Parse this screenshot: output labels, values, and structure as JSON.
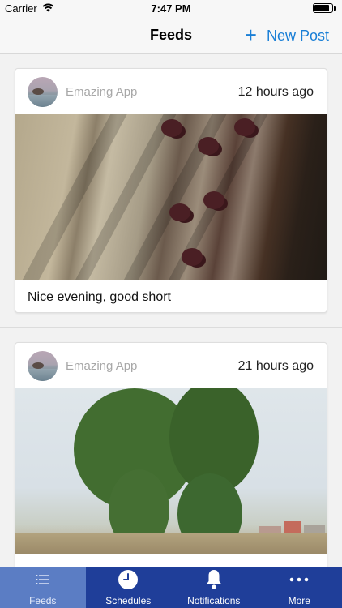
{
  "status_bar": {
    "carrier": "Carrier",
    "time": "7:47 PM",
    "battery_level": 0.85
  },
  "nav": {
    "title": "Feeds",
    "new_post_label": "New Post",
    "accent_color": "#1a7fd6"
  },
  "posts": [
    {
      "author": "Emazing App",
      "time_ago": "12 hours ago",
      "caption": "Nice evening, good short",
      "image": "curtain-photo"
    },
    {
      "author": "Emazing App",
      "time_ago": "21 hours ago",
      "caption": "",
      "image": "tree-photo"
    }
  ],
  "tab_bar": {
    "background_color": "#1f3e99",
    "active_color": "#5b7dc4",
    "tabs": [
      {
        "label": "Feeds",
        "icon": "list-icon",
        "active": true
      },
      {
        "label": "Schedules",
        "icon": "clock-icon",
        "active": false
      },
      {
        "label": "Notifications",
        "icon": "bell-icon",
        "active": false
      },
      {
        "label": "More",
        "icon": "more-dots-icon",
        "active": false
      }
    ]
  }
}
